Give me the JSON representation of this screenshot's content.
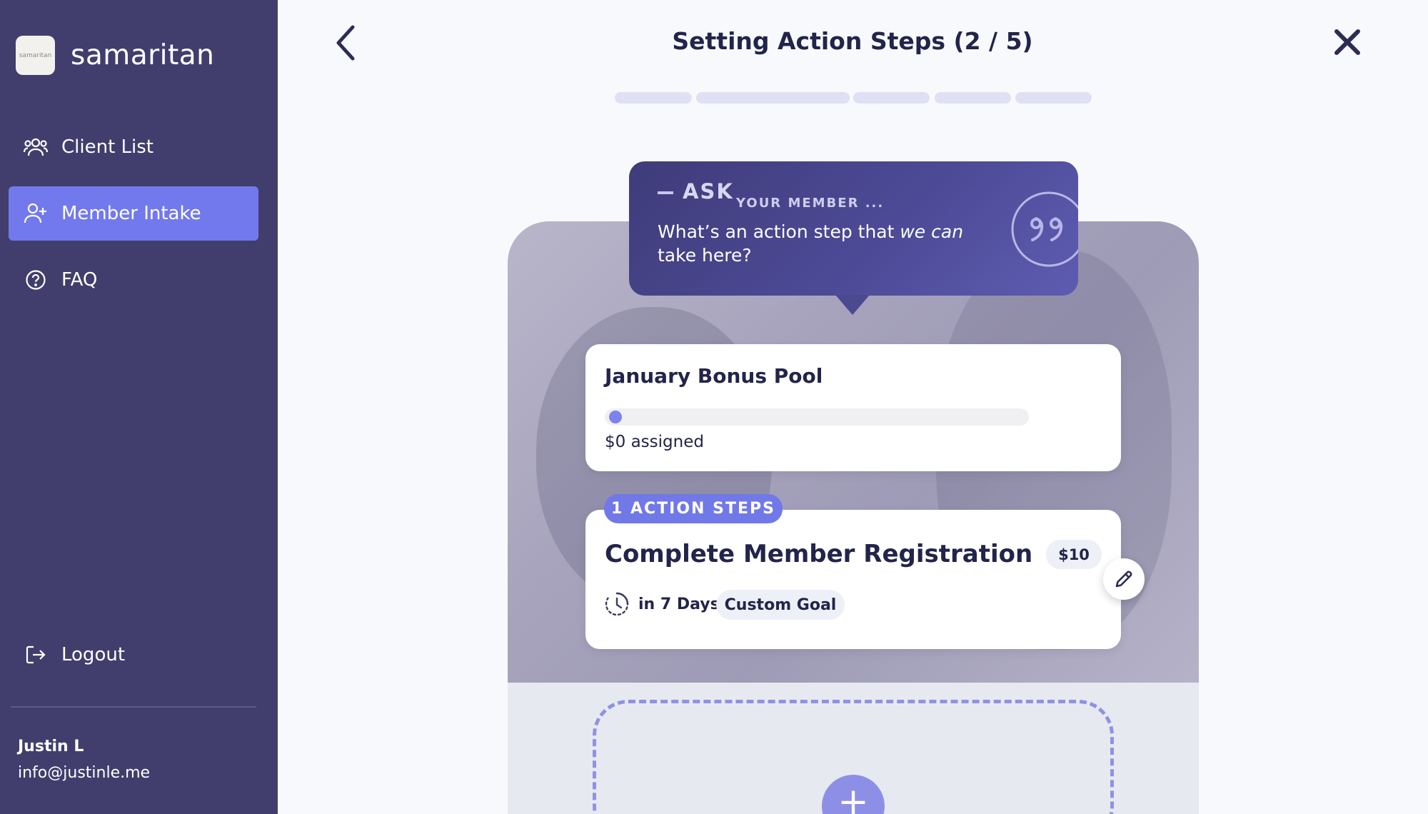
{
  "sidebar": {
    "brand": {
      "name": "samaritan",
      "logo_text": "samaritan"
    },
    "items": [
      {
        "label": "Client List",
        "icon": "users-icon",
        "active": false
      },
      {
        "label": "Member Intake",
        "icon": "add-user-icon",
        "active": true
      },
      {
        "label": "FAQ",
        "icon": "help-circle-icon",
        "active": false
      }
    ],
    "logout_label": "Logout",
    "user": {
      "name": "Justin L",
      "email": "info@justinle.me"
    }
  },
  "header": {
    "title": "Setting Action Steps (2 / 5)",
    "back_icon": "chevron-left-icon",
    "close_icon": "close-icon",
    "progress": {
      "current": 2,
      "total": 5
    }
  },
  "ask": {
    "label": "ASK",
    "sublabel": "YOUR MEMBER ...",
    "question_before": "What’s an action step that ",
    "question_emphasis": "we can",
    "question_after": " take here?",
    "icon": "quote-icon"
  },
  "bonus_pool": {
    "title": "January Bonus Pool",
    "assigned_label": "$0 assigned",
    "assigned_fraction": 0
  },
  "action_steps": {
    "badge": "1 ACTION STEPS",
    "items": [
      {
        "title": "Complete Member Registration",
        "amount": "$10",
        "due": "in 7 Days",
        "tag": "Custom Goal"
      }
    ]
  },
  "add_button_label": "+",
  "colors": {
    "sidebar": "#413e6d",
    "accent": "#7279ed",
    "ask_bubble": "#4c4a95",
    "text": "#22244a"
  }
}
